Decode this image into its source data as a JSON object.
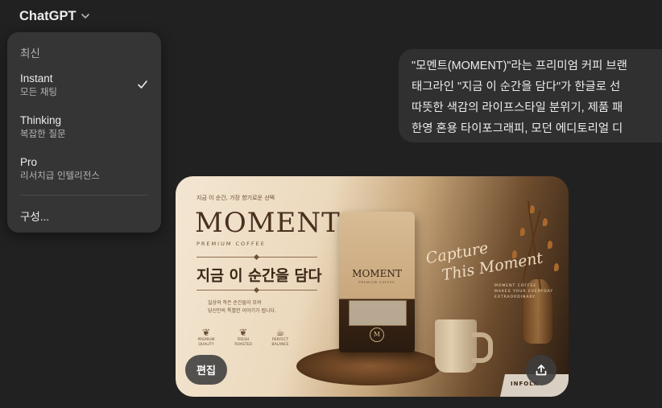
{
  "header": {
    "title": "ChatGPT",
    "chevron_icon": "chevron-down-icon"
  },
  "model_menu": {
    "section_title": "최신",
    "items": [
      {
        "label": "Instant",
        "sub": "모든 채팅",
        "selected": true
      },
      {
        "label": "Thinking",
        "sub": "복잡한 질문",
        "selected": false
      },
      {
        "label": "Pro",
        "sub": "리서치급 인텔리전스",
        "selected": false
      }
    ],
    "configure": "구성...",
    "check_icon": "checkmark-icon"
  },
  "user_message": {
    "lines": [
      "\"모멘트(MOMENT)\"라는 프리미엄 커피 브랜",
      "태그라인 \"지금 이 순간을 담다\"가 한글로 선",
      "따뜻한 색감의 라이프스타일 분위기, 제품 패",
      "한영 혼용 타이포그래피, 모던 에디토리얼 디"
    ]
  },
  "generated_image": {
    "top_caption": "지금 이 순간, 가장 향기로운 선택",
    "brand": "MOMENT",
    "premium": "PREMIUM COFFEE",
    "headline": "지금 이 순간을 담다",
    "body_lines": [
      "일상의 작은 순간들이 모여",
      "당신만의 특별한 이야기가 됩니다."
    ],
    "features": [
      {
        "icon": "leaf-icon",
        "label": "PREMIUM QUALITY"
      },
      {
        "icon": "leaf-icon",
        "label": "FRESH ROASTED"
      },
      {
        "icon": "cup-icon",
        "label": "PERFECT BALANCE"
      }
    ],
    "pouch_brand": "MOMENT",
    "pouch_sub": "PREMIUM COFFEE",
    "pouch_logo": "M",
    "script_line1": "Capture",
    "script_line2": "This Moment",
    "right_small_lines": [
      "MOMENT COFFEE",
      "MAKES YOUR EVERYDAY",
      "EXTRAORDINARY."
    ],
    "book_text": "INFOLK"
  },
  "actions": {
    "edit_label": "편집",
    "share_icon": "share-upload-icon"
  },
  "colors": {
    "background": "#212121",
    "menu_bg": "#353535",
    "bubble_bg": "#303030",
    "text_primary": "#ececec",
    "text_secondary": "#b4b4b4"
  }
}
